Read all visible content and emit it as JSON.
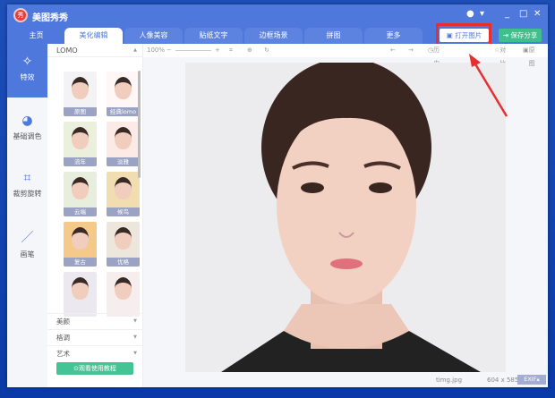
{
  "app": {
    "title": "美图秀秀",
    "logo_text": "秀"
  },
  "tabs": [
    {
      "label": "主页"
    },
    {
      "label": "美化编辑"
    },
    {
      "label": "人像美容"
    },
    {
      "label": "贴纸文字"
    },
    {
      "label": "边框场景"
    },
    {
      "label": "拼图"
    },
    {
      "label": "更多"
    }
  ],
  "header": {
    "open_label": "打开图片",
    "save_label": "保存分享"
  },
  "sidebar": {
    "items": [
      {
        "label": "特效",
        "icon": "magic-wand-icon"
      },
      {
        "label": "基础调色",
        "icon": "palette-icon"
      },
      {
        "label": "裁剪旋转",
        "icon": "crop-icon"
      },
      {
        "label": "画笔",
        "icon": "brush-icon"
      }
    ]
  },
  "panel": {
    "title": "LOMO",
    "filters": [
      {
        "label": "原图"
      },
      {
        "label": "经典lomo"
      },
      {
        "label": "流年"
      },
      {
        "label": "淡雅"
      },
      {
        "label": "云端"
      },
      {
        "label": "候鸟"
      },
      {
        "label": "复古"
      },
      {
        "label": "优格"
      },
      {
        "label": ""
      },
      {
        "label": ""
      }
    ],
    "categories": [
      {
        "label": "美颜"
      },
      {
        "label": "格调"
      },
      {
        "label": "艺术"
      }
    ],
    "tutorial_label": "观看使用教程"
  },
  "toolbar": {
    "zoom": "100%",
    "history": "历史列表",
    "compare": "对比",
    "original": "原图"
  },
  "footer": {
    "filename": "timg.jpg",
    "dimensions": "604 x 585",
    "exif": "EXIF"
  }
}
